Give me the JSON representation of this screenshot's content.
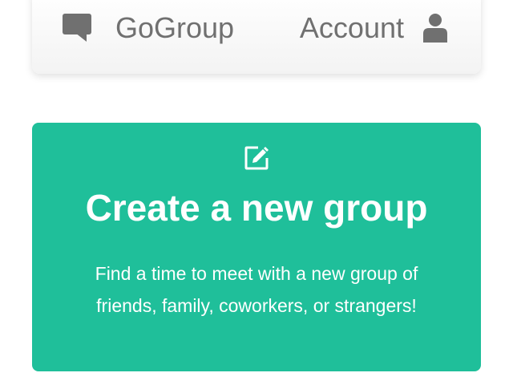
{
  "navbar": {
    "brand_icon": "speech-bubble-icon",
    "brand_label": "GoGroup",
    "account_label": "Account",
    "account_icon": "user-icon"
  },
  "card": {
    "icon": "edit-icon",
    "title": "Create a new group",
    "description": "Find a time to meet with a new group of friends, family, coworkers, or strangers!"
  },
  "colors": {
    "accent": "#1fbf9a",
    "nav_text": "#707070",
    "nav_bg": "#f7f7f7",
    "card_text": "#ffffff"
  }
}
